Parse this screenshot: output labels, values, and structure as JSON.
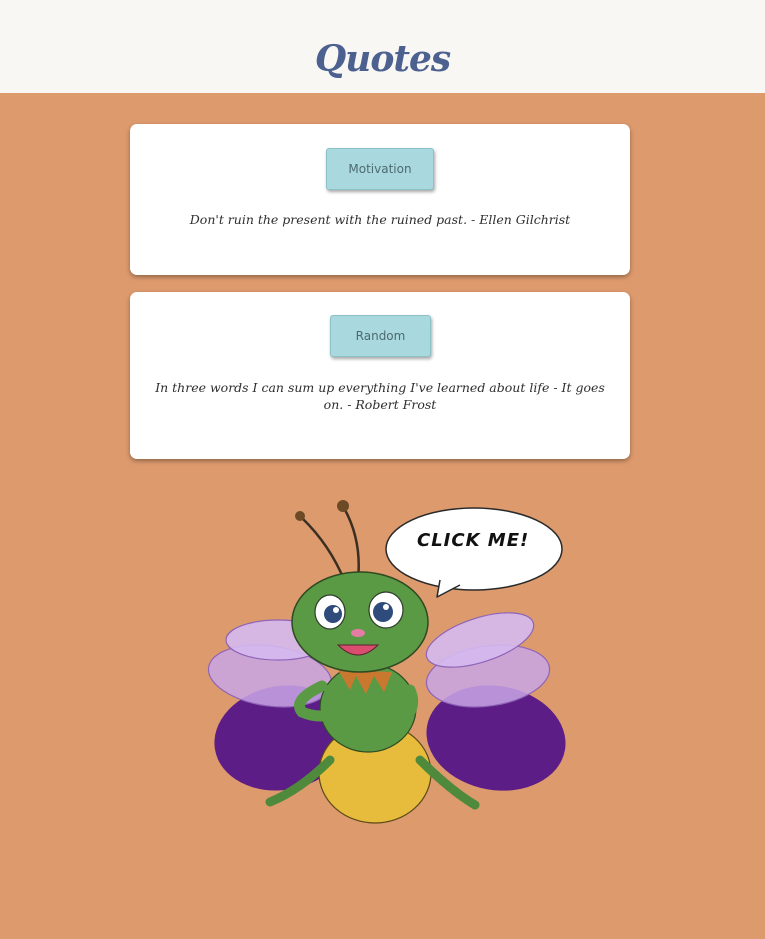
{
  "header": {
    "title": "Quotes"
  },
  "cards": [
    {
      "category": "Motivation",
      "quote": "Don't ruin the present with the ruined past. - Ellen Gilchrist"
    },
    {
      "category": "Random",
      "quote": "In three words I can sum up everything I've learned about life - It goes on. - Robert Frost"
    }
  ],
  "mascot": {
    "bubble_text": "CLICK ME!",
    "icon": "firefly-mascot-icon"
  },
  "colors": {
    "page_background": "#dd9a6d",
    "header_background": "#f8f7f3",
    "title": "#4d6190",
    "button": "#a9d8de",
    "card": "#ffffff"
  }
}
